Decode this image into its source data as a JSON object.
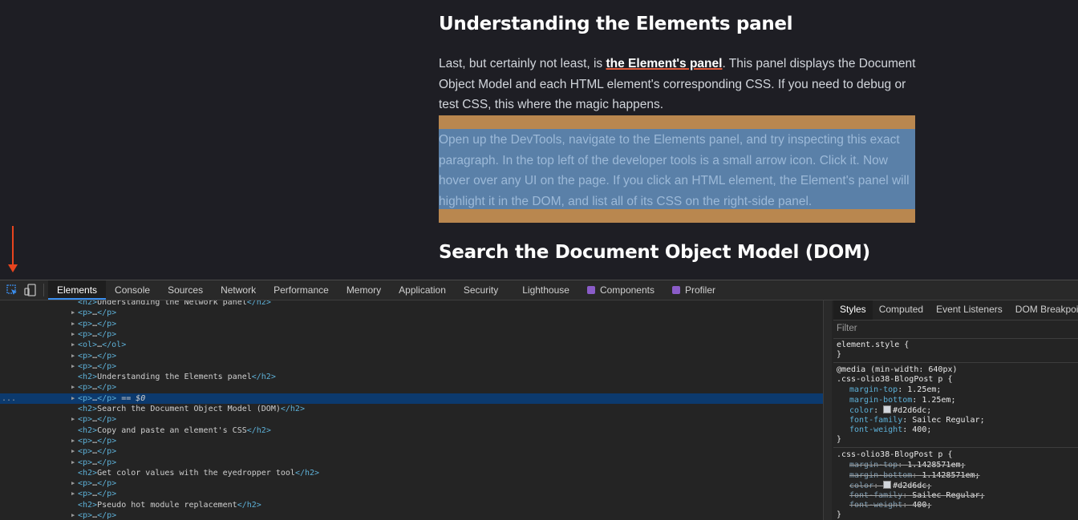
{
  "article": {
    "heading1": "Understanding the Elements panel",
    "para1_before": "Last, but certainly not least, is ",
    "para1_link": "the Element's panel",
    "para1_after": ". This panel displays the Document Object Model and each HTML element's corresponding CSS. If you need to debug or test CSS, this where the magic happens.",
    "para2": "Open up the DevTools, navigate to the Elements panel, and try inspecting this exact paragraph. In the top left of the developer tools is a small arrow icon. Click it. Now hover over any UI on the page. If you click an HTML element, the Element's panel will highlight it in the DOM, and list all of its CSS on the right-side panel.",
    "heading2": "Search the Document Object Model (DOM)"
  },
  "devtools": {
    "tabs": [
      "Elements",
      "Console",
      "Sources",
      "Network",
      "Performance",
      "Memory",
      "Application",
      "Security",
      "Lighthouse",
      "Components",
      "Profiler"
    ],
    "active_tab": "Elements",
    "dom_rows": [
      {
        "expandable": false,
        "open": "<h2>",
        "text": "Understanding the Network panel",
        "close": "</h2>"
      },
      {
        "expandable": true,
        "open": "<p>",
        "text": "…",
        "close": "</p>"
      },
      {
        "expandable": true,
        "open": "<p>",
        "text": "…",
        "close": "</p>"
      },
      {
        "expandable": true,
        "open": "<p>",
        "text": "…",
        "close": "</p>"
      },
      {
        "expandable": true,
        "open": "<ol>",
        "text": "…",
        "close": "</ol>"
      },
      {
        "expandable": true,
        "open": "<p>",
        "text": "…",
        "close": "</p>"
      },
      {
        "expandable": true,
        "open": "<p>",
        "text": "…",
        "close": "</p>"
      },
      {
        "expandable": false,
        "open": "<h2>",
        "text": "Understanding the Elements panel",
        "close": "</h2>"
      },
      {
        "expandable": true,
        "open": "<p>",
        "text": "…",
        "close": "</p>"
      },
      {
        "expandable": true,
        "open": "<p>",
        "text": "…",
        "close": "</p>",
        "selected": true,
        "suffix": " == ",
        "marker": "$0"
      },
      {
        "expandable": false,
        "open": "<h2>",
        "text": "Search the Document Object Model (DOM)",
        "close": "</h2>"
      },
      {
        "expandable": true,
        "open": "<p>",
        "text": "…",
        "close": "</p>"
      },
      {
        "expandable": false,
        "open": "<h2>",
        "text": "Copy and paste an element's CSS",
        "close": "</h2>"
      },
      {
        "expandable": true,
        "open": "<p>",
        "text": "…",
        "close": "</p>"
      },
      {
        "expandable": true,
        "open": "<p>",
        "text": "…",
        "close": "</p>"
      },
      {
        "expandable": true,
        "open": "<p>",
        "text": "…",
        "close": "</p>"
      },
      {
        "expandable": false,
        "open": "<h2>",
        "text": "Get color values with the eyedropper tool",
        "close": "</h2>"
      },
      {
        "expandable": true,
        "open": "<p>",
        "text": "…",
        "close": "</p>"
      },
      {
        "expandable": true,
        "open": "<p>",
        "text": "…",
        "close": "</p>"
      },
      {
        "expandable": false,
        "open": "<h2>",
        "text": "Pseudo hot module replacement",
        "close": "</h2>"
      },
      {
        "expandable": true,
        "open": "<p>",
        "text": "…",
        "close": "</p>"
      }
    ],
    "selected_row_dots": "...",
    "styles": {
      "tabs": [
        "Styles",
        "Computed",
        "Event Listeners",
        "DOM Breakpoints"
      ],
      "active_tab": "Styles",
      "filter_placeholder": "Filter",
      "element_style_open": "element.style {",
      "close_brace": "}",
      "media": "@media (min-width: 640px)",
      "rule1_selector": ".css-olio38-BlogPost p {",
      "rule1_props": [
        {
          "name": "margin-top",
          "value": "1.25em;"
        },
        {
          "name": "margin-bottom",
          "value": "1.25em;"
        },
        {
          "name": "color",
          "value": "#d2d6dc;",
          "swatch": true
        },
        {
          "name": "font-family",
          "value": "Sailec Regular;"
        },
        {
          "name": "font-weight",
          "value": "400;"
        }
      ],
      "rule2_selector": ".css-olio38-BlogPost p {",
      "rule2_props": [
        {
          "name": "margin-top",
          "value": "1.1428571em;"
        },
        {
          "name": "margin-bottom",
          "value": "1.1428571em;"
        },
        {
          "name": "color",
          "value": "#d2d6dc;",
          "swatch": true
        },
        {
          "name": "font-family",
          "value": "Sailec Regular;"
        },
        {
          "name": "font-weight",
          "value": "400;"
        }
      ]
    }
  },
  "colors": {
    "page_bg": "#1e1e24",
    "margin_highlight": "#b9874f",
    "content_highlight": "#5a80a8",
    "selected_row": "#0c3a6e",
    "arrow": "#e8441e",
    "tag": "#5db0d7"
  }
}
